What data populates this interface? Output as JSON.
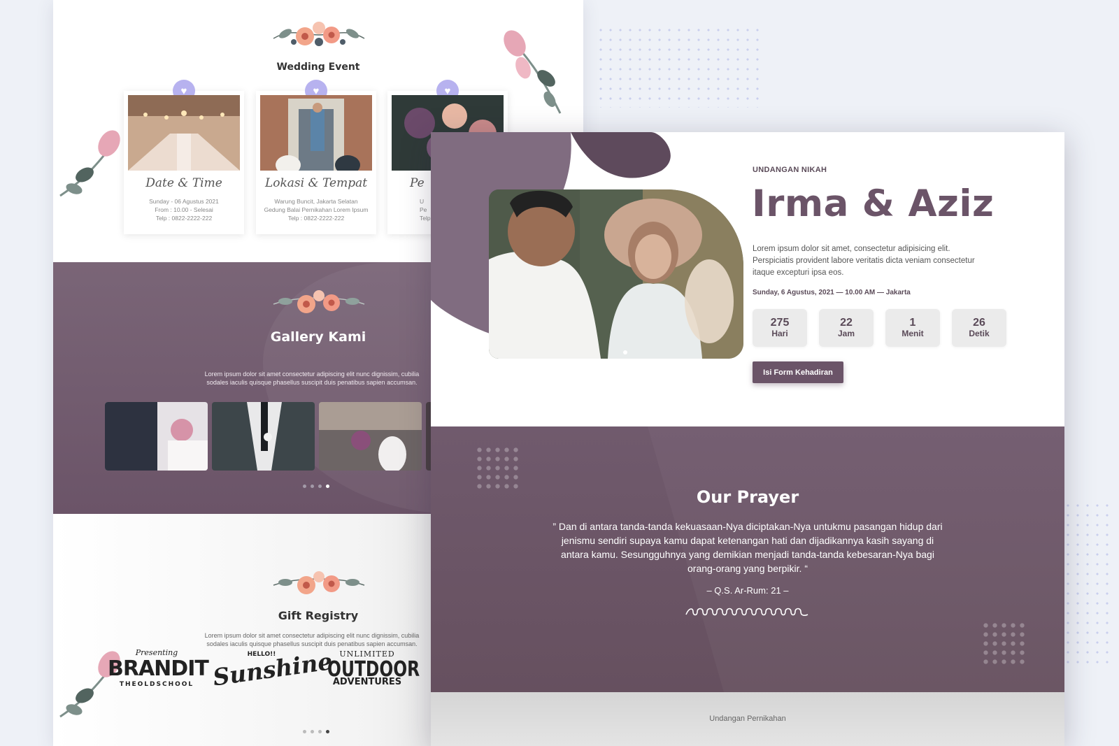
{
  "colors": {
    "accent": "#6b5468",
    "heart": "#b7b2ef",
    "background": "#eef1f7"
  },
  "back_page": {
    "wedding_event": {
      "title": "Wedding Event",
      "cards": [
        {
          "heading": "Date & Time",
          "lines": [
            "Sunday - 06 Agustus 2021",
            "From : 10.00 - Selesai",
            "Telp : 0822-2222-222"
          ]
        },
        {
          "heading": "Lokasi & Tempat",
          "lines": [
            "Warung Buncit, Jakarta Selatan",
            "Gedung Balai Pernikahan Lorem Ipsum",
            "Telp : 0822-2222-222"
          ]
        },
        {
          "heading": "Pe",
          "lines": [
            "U",
            "Pe",
            "Telp"
          ]
        }
      ],
      "icon": "heart-icon"
    },
    "gallery": {
      "title": "Gallery Kami",
      "text": "Lorem ipsum dolor sit amet consectetur adipiscing elit nunc dignissim, cubilia sodales iaculis quisque phasellus suscipit duis penatibus sapien accumsan.",
      "active_dot": 4
    },
    "gift": {
      "title": "Gift Registry",
      "text": "Lorem ipsum dolor sit amet consectetur adipiscing elit nunc dignissim, cubilia sodales iaculis quisque phasellus suscipit duis penatibus sapien accumsan.",
      "logos": {
        "brandit": {
          "top": "Presenting",
          "main": "BRANDIT",
          "bottom": "THEOLDSCHOOL"
        },
        "sunshine": {
          "top": "HELLO!!",
          "main": "Sunshine"
        },
        "outdoor": {
          "top": "UNLIMITED",
          "main": "OUTDOOR",
          "sub": "ADVENTURES"
        }
      },
      "active_dot": 4
    }
  },
  "hero": {
    "kicker": "UNDANGAN NIKAH",
    "names": "Irma & Aziz",
    "intro": "Lorem ipsum dolor sit amet, consectetur adipisicing elit. Perspiciatis provident labore veritatis dicta veniam consectetur itaque excepturi ipsa eos.",
    "datetime": "Sunday, 6 Agustus, 2021 — 10.00 AM — Jakarta",
    "countdown": [
      {
        "value": "275",
        "unit": "Hari"
      },
      {
        "value": "22",
        "unit": "Jam"
      },
      {
        "value": "1",
        "unit": "Menit"
      },
      {
        "value": "26",
        "unit": "Detik"
      }
    ],
    "rsvp_label": "Isi Form Kehadiran"
  },
  "prayer": {
    "title": "Our Prayer",
    "verse": "” Dan di antara tanda-tanda kekuasaan-Nya diciptakan-Nya untukmu pasangan hidup dari jenismu sendiri supaya kamu dapat ketenangan hati dan dijadikannya kasih sayang di antara kamu. Sesungguhnya yang demikian menjadi tanda-tanda kebesaran-Nya bagi orang-orang yang berpikir. “",
    "reference": "– Q.S. Ar-Rum: 21 –"
  },
  "footer": {
    "text": "Undangan Pernikahan"
  }
}
